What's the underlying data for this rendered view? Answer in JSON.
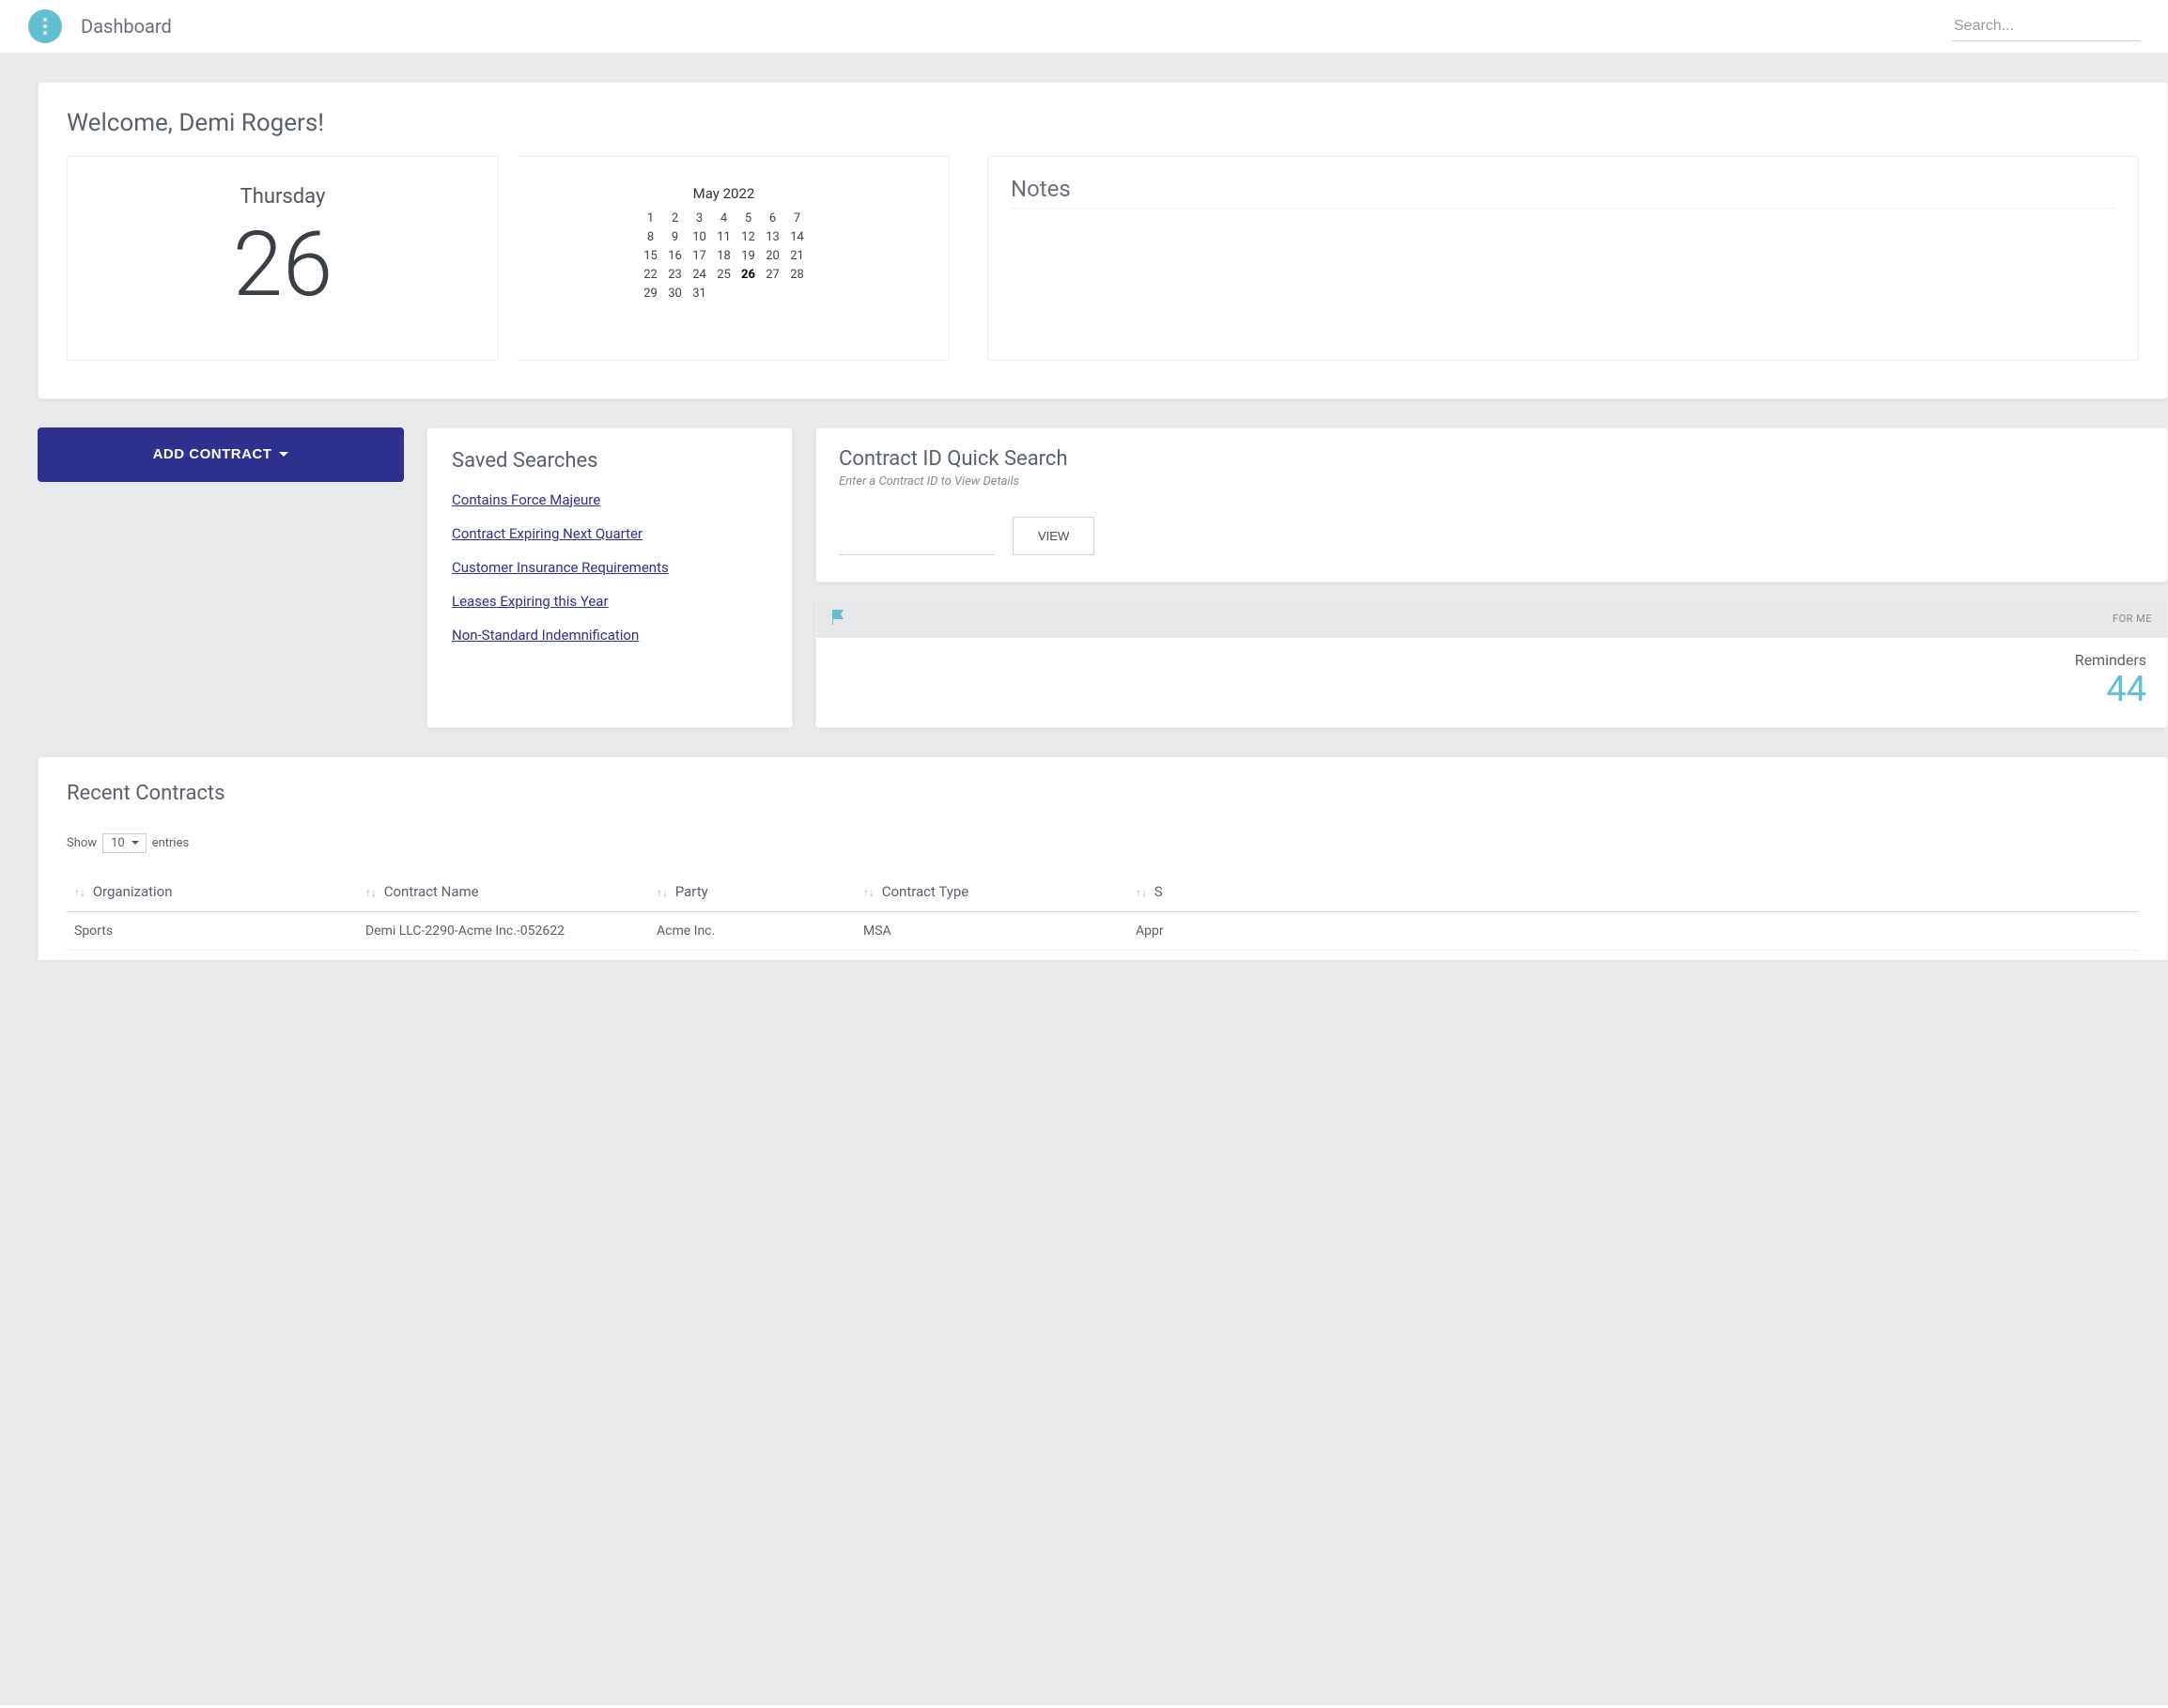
{
  "header": {
    "title": "Dashboard",
    "search_placeholder": "Search..."
  },
  "welcome": {
    "greeting": "Welcome, Demi Rogers!",
    "day_name": "Thursday",
    "day_number": "26",
    "month_label": "May 2022",
    "today": 26,
    "days": [
      1,
      2,
      3,
      4,
      5,
      6,
      7,
      8,
      9,
      10,
      11,
      12,
      13,
      14,
      15,
      16,
      17,
      18,
      19,
      20,
      21,
      22,
      23,
      24,
      25,
      26,
      27,
      28,
      29,
      30,
      31
    ]
  },
  "notes": {
    "title": "Notes"
  },
  "add_contract_label": "ADD CONTRACT",
  "saved_searches": {
    "title": "Saved Searches",
    "items": [
      "Contains Force Majeure",
      "Contract Expiring Next Quarter",
      "Customer Insurance Requirements",
      "Leases Expiring this Year",
      "Non-Standard Indemnification"
    ]
  },
  "quick_search": {
    "title": "Contract ID Quick Search",
    "subtitle": "Enter a Contract ID to View Details",
    "view_label": "VIEW"
  },
  "reminders": {
    "for_me": "FOR ME",
    "label": "Reminders",
    "count": "44"
  },
  "recent": {
    "title": "Recent Contracts",
    "show_label": "Show",
    "entries_label": "entries",
    "page_size": "10",
    "columns": [
      "Organization",
      "Contract Name",
      "Party",
      "Contract Type",
      "S"
    ],
    "rows": [
      {
        "org": "Sports",
        "name": "Demi LLC-2290-Acme Inc.-052622",
        "party": "Acme Inc.",
        "type": "MSA",
        "status": "Appr"
      }
    ]
  }
}
